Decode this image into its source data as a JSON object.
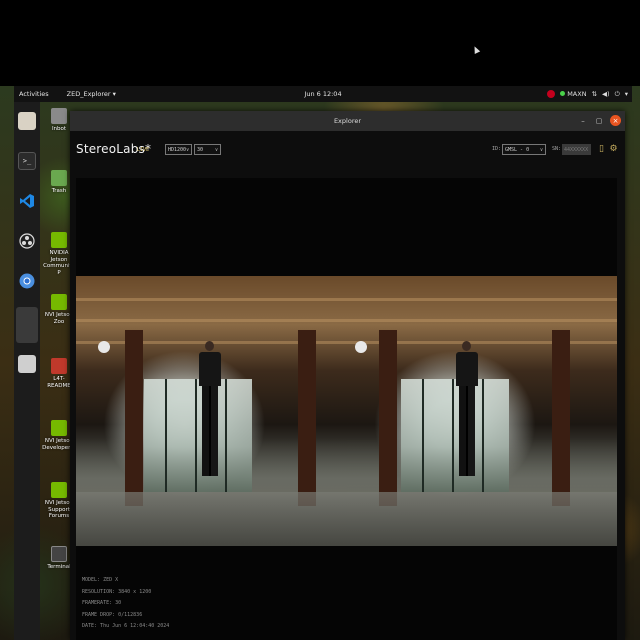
{
  "topbar": {
    "activities": "Activities",
    "app_menu": "ZED_Explorer ▾",
    "clock": "Jun 6  12:04",
    "maxn": "MAXN",
    "icons": [
      "nvidia-icon",
      "network-icon",
      "volume-icon",
      "power-icon",
      "menu-arrow-icon"
    ]
  },
  "dock": {
    "items": [
      "files",
      "terminal",
      "vscode",
      "obs",
      "chromium",
      "zed-explorer",
      "disk"
    ]
  },
  "desktop": {
    "icons": [
      {
        "label": "Inbot",
        "icon": "folder-icon"
      },
      {
        "label": "Trash",
        "icon": "trash-icon"
      },
      {
        "label": "NVIDIA Jetson Community P",
        "icon": "nvidia-icon"
      },
      {
        "label": "NVI Jetson Zoo",
        "icon": "nvidia-icon"
      },
      {
        "label": "L4T-README",
        "icon": "folder-icon"
      },
      {
        "label": "NVI Jetson Developer Z",
        "icon": "nvidia-icon"
      },
      {
        "label": "NVI Jetson Support Forums",
        "icon": "nvidia-icon"
      },
      {
        "label": "Terminal",
        "icon": "terminal-icon"
      }
    ]
  },
  "window": {
    "title": "Explorer",
    "minimize": "–",
    "maximize": "▢",
    "close": "×"
  },
  "app": {
    "brand": "StereoLabs*",
    "live": "LIVE",
    "resolution": "HD1200",
    "fps": "30",
    "id_label": "ID:",
    "device_id": "GMSL - 0",
    "sn_label": "SN:",
    "serial": "44XXXXXX",
    "icons": [
      "battery-icon",
      "gear-icon"
    ]
  },
  "info": {
    "model": "MODEL: ZED X",
    "resolution": "RESOLUTION: 3840 x 1200",
    "framerate": "FRAMERATE: 30",
    "frame_drop": "FRAME DROP: 0/112836",
    "date": "DATE: Thu Jun 6 12:04:40 2024"
  }
}
